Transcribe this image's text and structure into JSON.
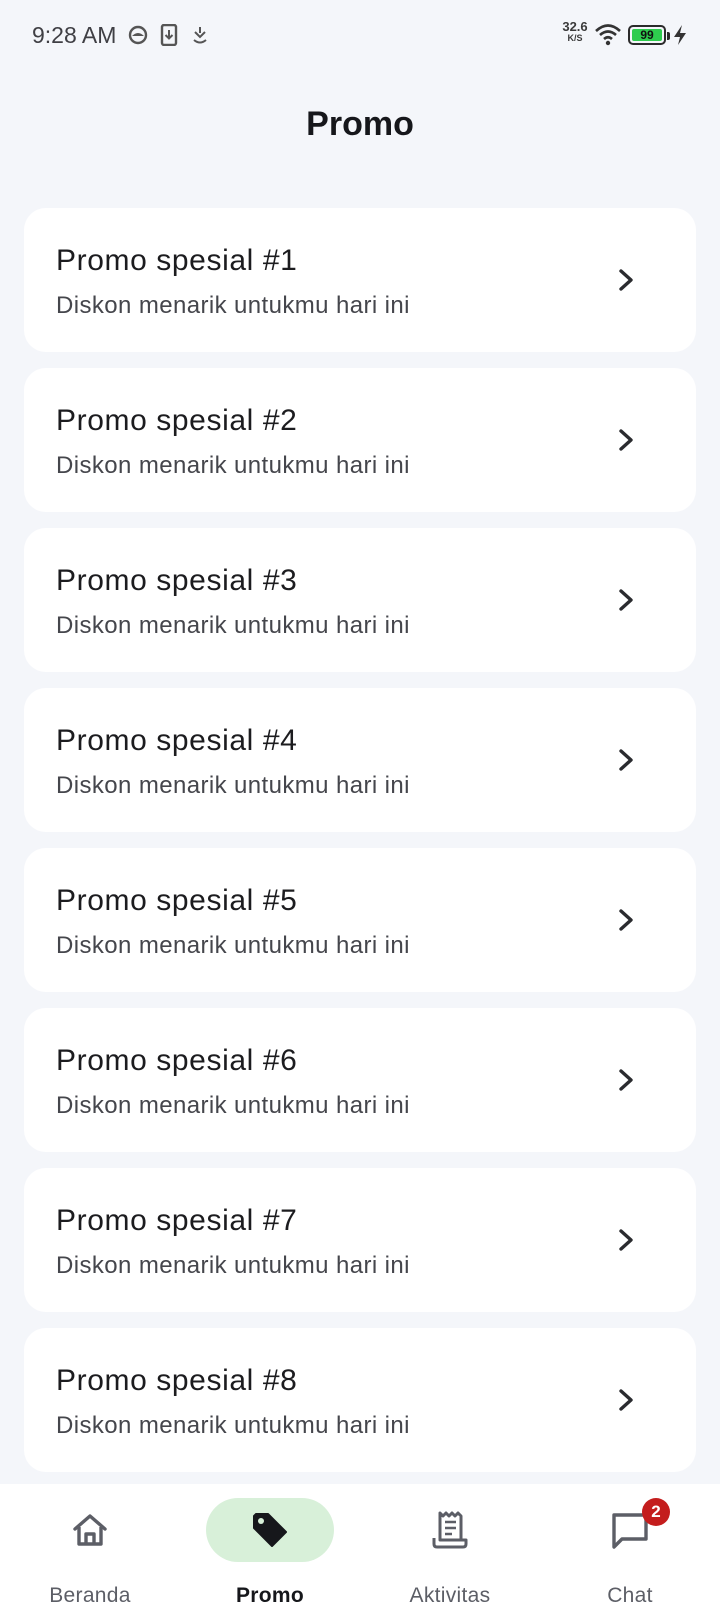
{
  "status_bar": {
    "time": "9:28 AM",
    "net_speed_value": "32.6",
    "net_speed_unit": "K/S",
    "battery_level": "99",
    "icons": [
      "headset-icon",
      "download-icon",
      "location-icon",
      "wifi-icon",
      "battery-icon",
      "charging-icon"
    ]
  },
  "header": {
    "title": "Promo"
  },
  "promos": [
    {
      "title": "Promo spesial #1",
      "subtitle": "Diskon menarik untukmu hari ini"
    },
    {
      "title": "Promo spesial #2",
      "subtitle": "Diskon menarik untukmu hari ini"
    },
    {
      "title": "Promo spesial #3",
      "subtitle": "Diskon menarik untukmu hari ini"
    },
    {
      "title": "Promo spesial #4",
      "subtitle": "Diskon menarik untukmu hari ini"
    },
    {
      "title": "Promo spesial #5",
      "subtitle": "Diskon menarik untukmu hari ini"
    },
    {
      "title": "Promo spesial #6",
      "subtitle": "Diskon menarik untukmu hari ini"
    },
    {
      "title": "Promo spesial #7",
      "subtitle": "Diskon menarik untukmu hari ini"
    },
    {
      "title": "Promo spesial #8",
      "subtitle": "Diskon menarik untukmu hari ini"
    }
  ],
  "bottom_nav": {
    "items": [
      {
        "label": "Beranda",
        "icon": "home-icon",
        "active": false
      },
      {
        "label": "Promo",
        "icon": "tag-icon",
        "active": true
      },
      {
        "label": "Aktivitas",
        "icon": "receipt-icon",
        "active": false
      },
      {
        "label": "Chat",
        "icon": "chat-icon",
        "active": false,
        "badge": "2"
      }
    ]
  },
  "colors": {
    "background": "#f4f6fa",
    "card": "#ffffff",
    "active_pill": "#d8f0d9",
    "badge": "#c41d1d",
    "battery_fill": "#2ecc4e"
  }
}
